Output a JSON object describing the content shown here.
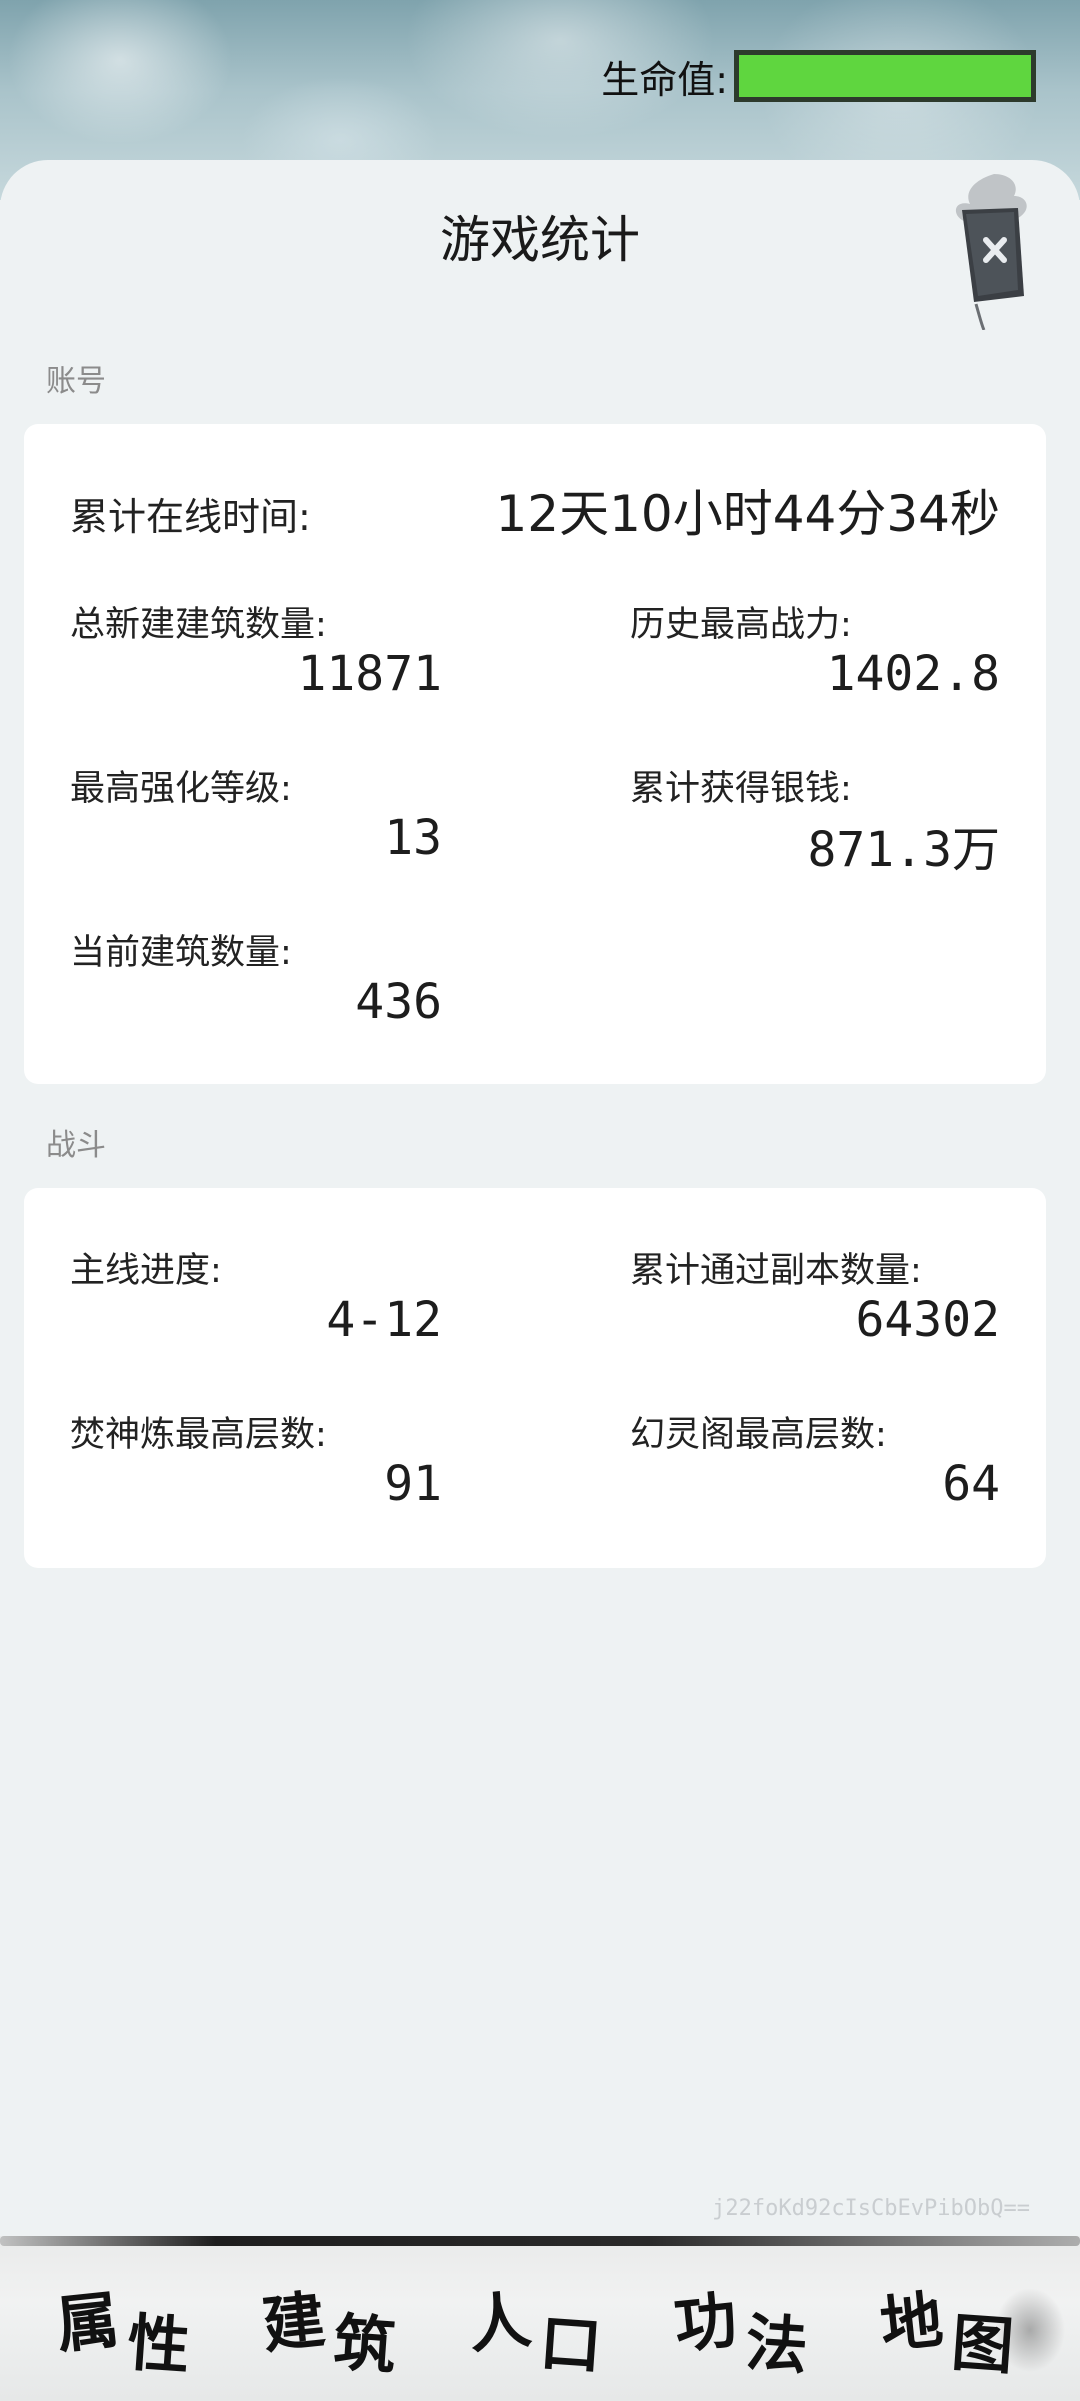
{
  "hud": {
    "hp_label": "生命值:",
    "hp_fraction": 1.0,
    "hp_color": "#5fd63f"
  },
  "panel": {
    "title": "游戏统计",
    "close_icon": "close-icon"
  },
  "account": {
    "section_label": "账号",
    "online_time_label": "累计在线时间:",
    "online_time_value": "12天10小时44分34秒",
    "stats": [
      {
        "label": "总新建建筑数量:",
        "value": "11871"
      },
      {
        "label": "历史最高战力:",
        "value": "1402.8"
      },
      {
        "label": "最高强化等级:",
        "value": "13"
      },
      {
        "label": "累计获得银钱:",
        "value": "871.3万"
      },
      {
        "label": "当前建筑数量:",
        "value": "436"
      }
    ]
  },
  "battle": {
    "section_label": "战斗",
    "stats": [
      {
        "label": "主线进度:",
        "value": "4-12"
      },
      {
        "label": "累计通过副本数量:",
        "value": "64302"
      },
      {
        "label": "焚神炼最高层数:",
        "value": "91"
      },
      {
        "label": "幻灵阁最高层数:",
        "value": "64"
      }
    ]
  },
  "watermark": "j22foKd92cIsCbEvPibObQ==",
  "nav": [
    {
      "c1": "属",
      "c2": "性"
    },
    {
      "c1": "建",
      "c2": "筑"
    },
    {
      "c1": "人",
      "c2": "口"
    },
    {
      "c1": "功",
      "c2": "法"
    },
    {
      "c1": "地",
      "c2": "图"
    }
  ]
}
